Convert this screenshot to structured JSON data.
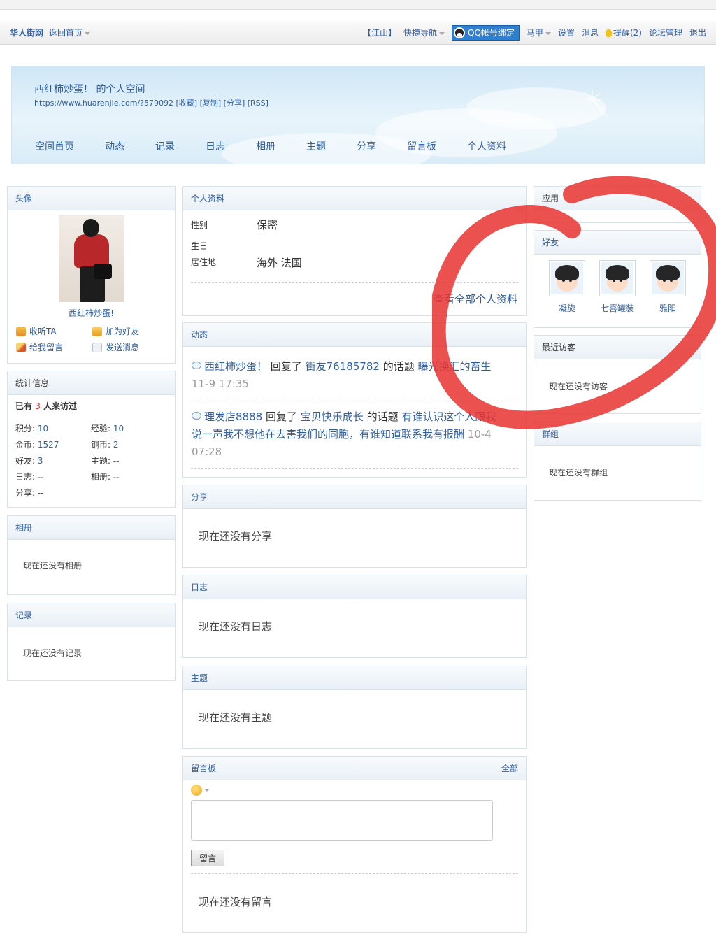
{
  "topbar": {
    "brand": "华人街网",
    "back_home": "返回首页",
    "region": "【江山】",
    "quick_nav": "快捷导航",
    "qq_bind": "QQ帐号绑定",
    "user": "马甲",
    "settings": "设置",
    "messages": "消息",
    "reminders": "提醒(2)",
    "forum_admin": "论坛管理",
    "logout": "退出"
  },
  "header": {
    "title": "西红柿炒蛋！ 的个人空间",
    "url": "https://www.huarenjie.com/?579092 [收藏] [复制] [分享] [RSS]",
    "nav": [
      "空间首页",
      "动态",
      "记录",
      "日志",
      "相册",
      "主题",
      "分享",
      "留言板",
      "个人资料"
    ]
  },
  "left": {
    "avatar_title": "头像",
    "username": "西红柿炒蛋!",
    "actions": {
      "follow": "收听TA",
      "add_friend": "加为好友",
      "leave_msg": "给我留言",
      "send_msg": "发送消息"
    },
    "stats_title": "统计信息",
    "visits_prefix": "已有",
    "visits_count": "3",
    "visits_suffix": "人来访过",
    "stats": [
      [
        "积分:",
        "10",
        "经验:",
        "10"
      ],
      [
        "金币:",
        "1527",
        "铜币:",
        "2"
      ],
      [
        "好友:",
        "3",
        "主题:",
        "--"
      ],
      [
        "日志:",
        "--",
        "相册:",
        "--"
      ],
      [
        "分享:",
        "--",
        "",
        ""
      ]
    ],
    "album_title": "相册",
    "album_empty": "现在还没有相册",
    "record_title": "记录",
    "record_empty": "现在还没有记录"
  },
  "profile": {
    "title": "个人资料",
    "gender_label": "性别",
    "gender_value": "保密",
    "birthday_label": "生日",
    "residence_label": "居住地",
    "residence_value": "海外 法国",
    "view_all": "查看全部个人资料"
  },
  "feed": {
    "title": "动态",
    "items": [
      {
        "user": "西红柿炒蛋！",
        "action": "回复了",
        "target_user": "街友76185782",
        "mid": "的话题",
        "topic": "曝光换汇的畜生",
        "time": "11-9 17:35"
      },
      {
        "user": "理发店8888",
        "action": "回复了",
        "target_user": "宝贝快乐成长",
        "mid": "的话题",
        "topic": "有谁认识这个人跟我说一声我不想他在去害我们的同胞，有谁知道联系我有报酬",
        "time": "10-4 07:28"
      }
    ]
  },
  "share": {
    "title": "分享",
    "empty": "现在还没有分享"
  },
  "blog": {
    "title": "日志",
    "empty": "现在还没有日志"
  },
  "topics": {
    "title": "主题",
    "empty": "现在还没有主题"
  },
  "guestbook": {
    "title": "留言板",
    "all": "全部",
    "submit": "留言",
    "empty": "现在还没有留言"
  },
  "right": {
    "apps_title": "应用",
    "friends_title": "好友",
    "friends": [
      "凝旋",
      "七喜罐装",
      "雅阳"
    ],
    "visitors_title": "最近访客",
    "visitors_empty": "现在还没有访客",
    "groups_title": "群组",
    "groups_empty": "现在还没有群组"
  },
  "colors": {
    "link": "#2f5ea3",
    "annotation_red": "#e8332f",
    "header_sky": "#cfe7f6"
  }
}
